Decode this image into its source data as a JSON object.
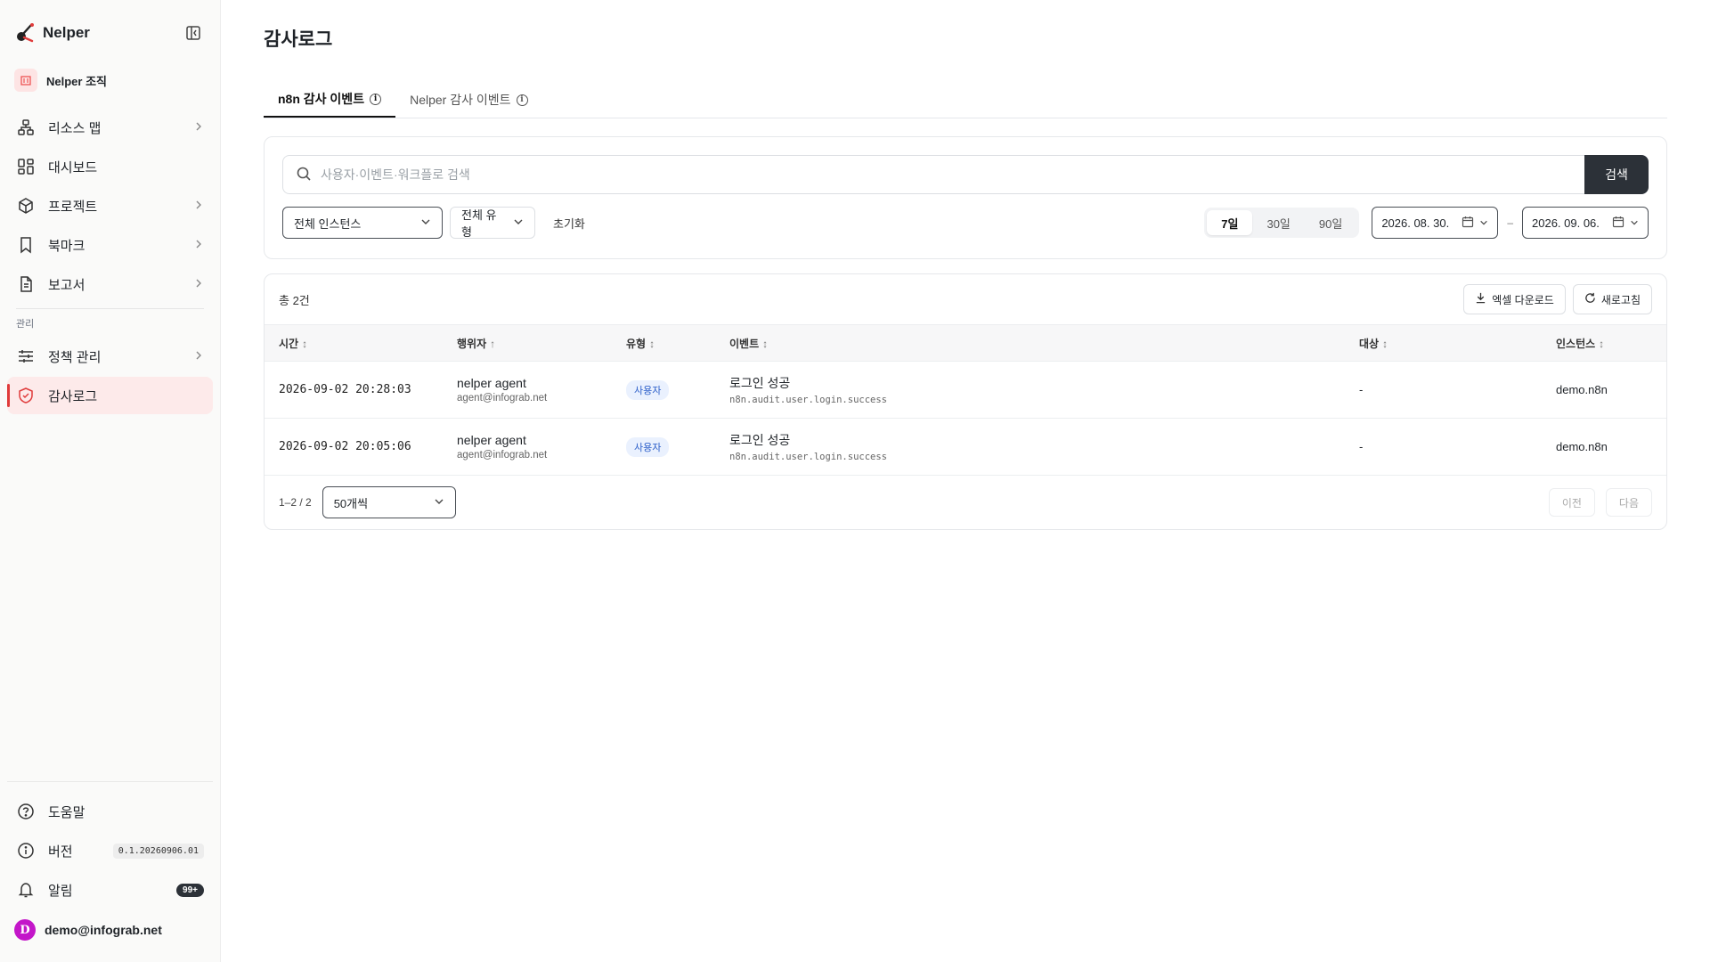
{
  "brand": {
    "name": "Nelper"
  },
  "org": {
    "name": "Nelper 조직"
  },
  "nav": {
    "items": [
      {
        "label": "리소스 맵"
      },
      {
        "label": "대시보드"
      },
      {
        "label": "프로젝트"
      },
      {
        "label": "북마크"
      },
      {
        "label": "보고서"
      }
    ],
    "admin_section_label": "관리",
    "admin_items": [
      {
        "label": "정책 관리"
      },
      {
        "label": "감사로그"
      }
    ]
  },
  "sidebar_bottom": {
    "help": "도움말",
    "version_label": "버전",
    "version_value": "0.1.20260906.01",
    "alerts_label": "알림",
    "alerts_count": "99+",
    "user_initial": "D",
    "user_email": "demo@infograb.net"
  },
  "page": {
    "title": "감사로그"
  },
  "tabs": [
    {
      "label": "n8n 감사 이벤트"
    },
    {
      "label": "Nelper 감사 이벤트"
    }
  ],
  "filters": {
    "search_placeholder": "사용자·이벤트·워크플로 검색",
    "search_button": "검색",
    "instance_select": "전체 인스턴스",
    "type_select": "전체 유형",
    "reset": "초기화",
    "ranges": [
      "7일",
      "30일",
      "90일"
    ],
    "active_range": "7일",
    "date_from": "2026. 08. 30.",
    "date_sep": "–",
    "date_to": "2026. 09. 06."
  },
  "table": {
    "total": "총 2건",
    "excel_button": "엑셀 다운로드",
    "refresh_button": "새로고침",
    "columns": [
      "시간",
      "행위자",
      "유형",
      "이벤트",
      "대상",
      "인스턴스"
    ],
    "rows": [
      {
        "time": "2026-09-02 20:28:03",
        "actor_name": "nelper agent",
        "actor_email": "agent@infograb.net",
        "type": "사용자",
        "event_name": "로그인 성공",
        "event_code": "n8n.audit.user.login.success",
        "target": "-",
        "instance": "demo.n8n"
      },
      {
        "time": "2026-09-02 20:05:06",
        "actor_name": "nelper agent",
        "actor_email": "agent@infograb.net",
        "type": "사용자",
        "event_name": "로그인 성공",
        "event_code": "n8n.audit.user.login.success",
        "target": "-",
        "instance": "demo.n8n"
      }
    ]
  },
  "pager": {
    "info": "1–2 / 2",
    "page_size": "50개씩",
    "prev": "이전",
    "next": "다음"
  },
  "colors": {
    "accent": "#e03b3b",
    "primary_dark": "#2c3138",
    "avatar": "#c316c9"
  }
}
